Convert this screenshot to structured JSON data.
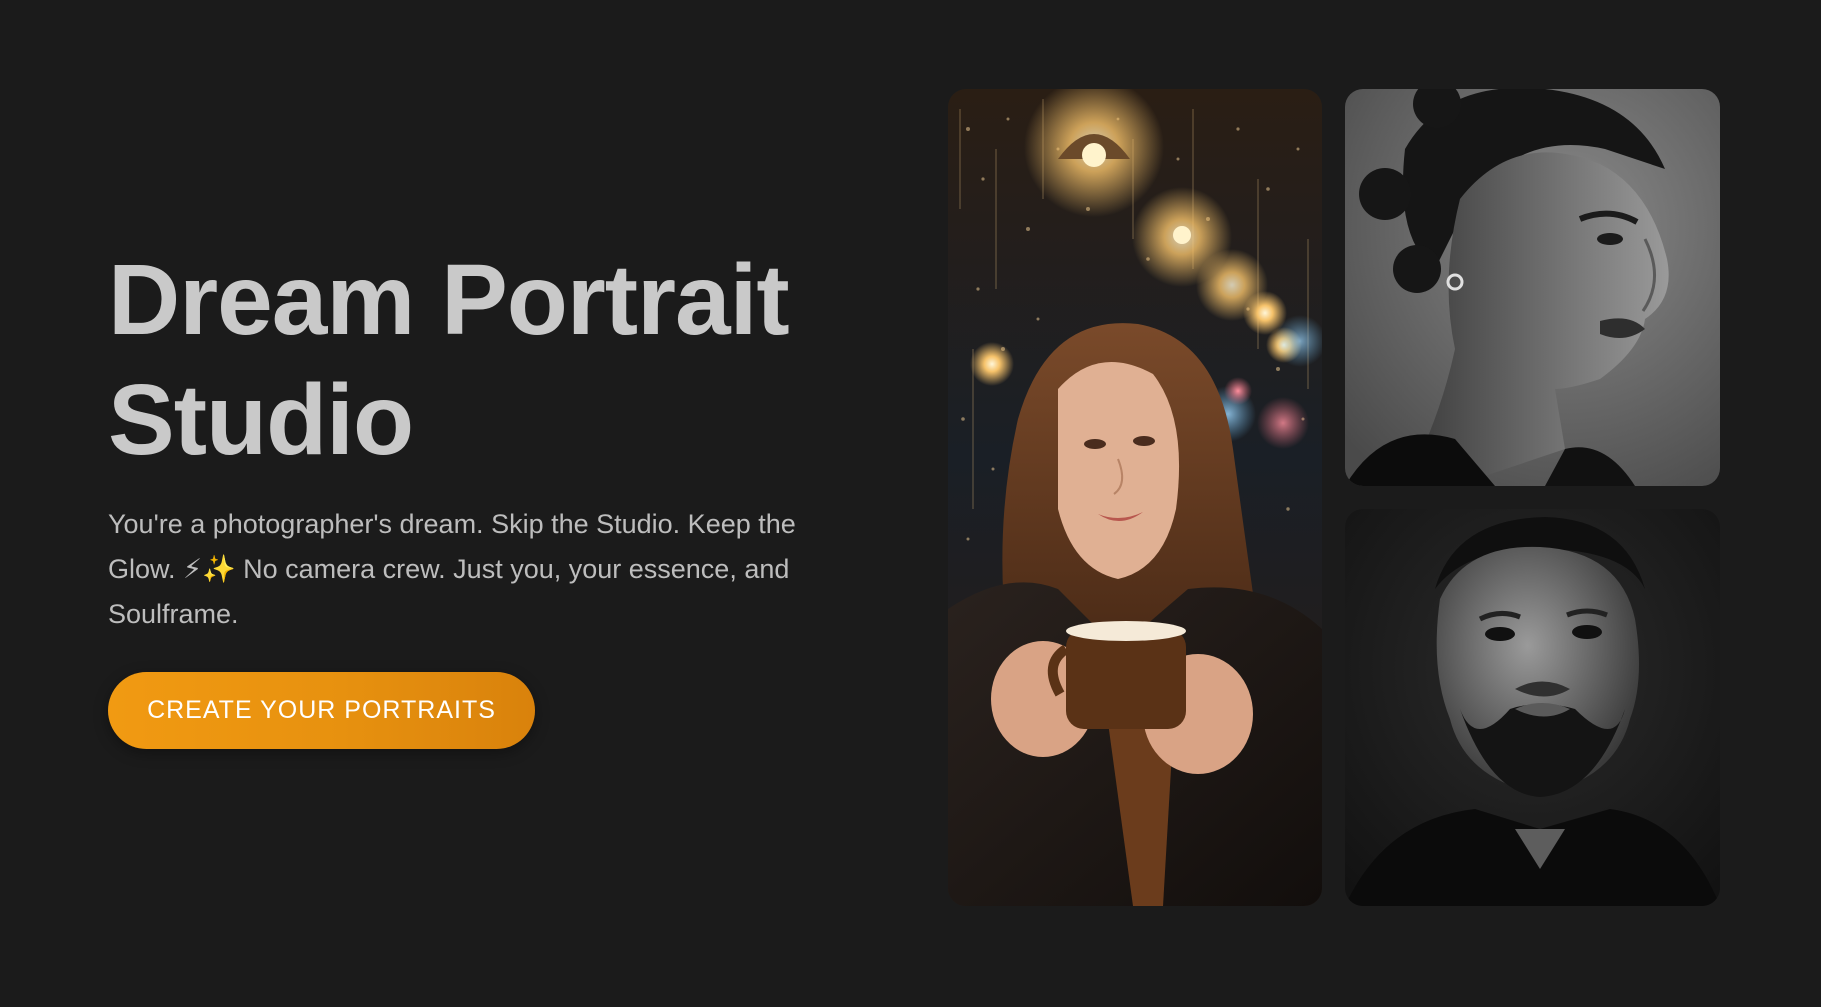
{
  "hero": {
    "title_line1": "Dream Portrait",
    "title_line2": "Studio",
    "subtitle": "You're a photographer's dream. Skip the Studio. Keep the Glow. ⚡✨ No camera crew. Just you, your essence, and Soulframe.",
    "cta_label": "CREATE YOUR PORTRAITS"
  },
  "colors": {
    "background": "#1b1b1b",
    "title": "#c9c9c9",
    "subtitle": "#bdbdbd",
    "accent": "#f19a12"
  },
  "gallery": [
    {
      "name": "cafe-portrait-photo",
      "style": "warm color, rainy window bokeh, woman holding coffee cup"
    },
    {
      "name": "woman-bw-portrait-photo",
      "style": "black and white profile portrait"
    },
    {
      "name": "man-bw-portrait-photo",
      "style": "black and white frontal portrait"
    }
  ]
}
